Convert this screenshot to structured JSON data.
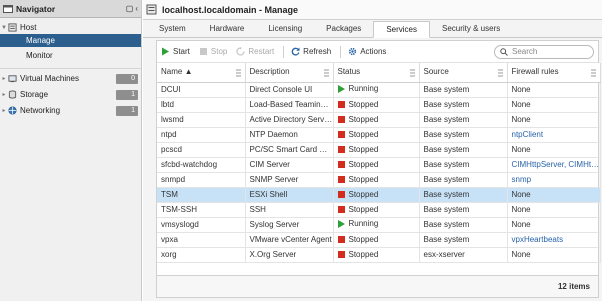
{
  "navigator": {
    "title": "Navigator",
    "items": [
      {
        "label": "Host",
        "type": "host"
      },
      {
        "label": "Manage",
        "type": "child"
      },
      {
        "label": "Monitor",
        "type": "child"
      },
      {
        "label": "Virtual Machines",
        "badge": "0"
      },
      {
        "label": "Storage",
        "badge": "1"
      },
      {
        "label": "Networking",
        "badge": "1"
      }
    ]
  },
  "main": {
    "title": "localhost.localdomain - Manage",
    "tabs": [
      "System",
      "Hardware",
      "Licensing",
      "Packages",
      "Services",
      "Security & users"
    ],
    "active_tab": "Services"
  },
  "toolbar": {
    "start": "Start",
    "stop": "Stop",
    "restart": "Restart",
    "refresh": "Refresh",
    "actions": "Actions",
    "search_placeholder": "Search"
  },
  "table": {
    "columns": [
      "Name ▲",
      "Description",
      "Status",
      "Source",
      "Firewall rules"
    ],
    "rows": [
      {
        "name": "DCUI",
        "desc": "Direct Console UI",
        "status": "Running",
        "source": "Base system",
        "fw": "None"
      },
      {
        "name": "lbtd",
        "desc": "Load-Based Teaming Daemon",
        "status": "Stopped",
        "source": "Base system",
        "fw": "None"
      },
      {
        "name": "lwsmd",
        "desc": "Active Directory Service",
        "status": "Stopped",
        "source": "Base system",
        "fw": "None"
      },
      {
        "name": "ntpd",
        "desc": "NTP Daemon",
        "status": "Stopped",
        "source": "Base system",
        "fw": "ntpClient"
      },
      {
        "name": "pcscd",
        "desc": "PC/SC Smart Card Daemon",
        "status": "Stopped",
        "source": "Base system",
        "fw": "None"
      },
      {
        "name": "sfcbd-watchdog",
        "desc": "CIM Server",
        "status": "Stopped",
        "source": "Base system",
        "fw": "CIMHttpServer, CIMHttpsServer"
      },
      {
        "name": "snmpd",
        "desc": "SNMP Server",
        "status": "Stopped",
        "source": "Base system",
        "fw": "snmp"
      },
      {
        "name": "TSM",
        "desc": "ESXi Shell",
        "status": "Stopped",
        "source": "Base system",
        "fw": "None"
      },
      {
        "name": "TSM-SSH",
        "desc": "SSH",
        "status": "Stopped",
        "source": "Base system",
        "fw": "None"
      },
      {
        "name": "vmsyslogd",
        "desc": "Syslog Server",
        "status": "Running",
        "source": "Base system",
        "fw": "None"
      },
      {
        "name": "vpxa",
        "desc": "VMware vCenter Agent",
        "status": "Stopped",
        "source": "Base system",
        "fw": "vpxHeartbeats"
      },
      {
        "name": "xorg",
        "desc": "X.Org Server",
        "status": "Stopped",
        "source": "esx-xserver",
        "fw": "None"
      }
    ],
    "selected_row": 7
  },
  "footer": {
    "count": "12 items"
  },
  "colors": {
    "selected_nav": "#2c5f8e",
    "selected_row": "#c7e2f7",
    "running": "#2fa037",
    "stopped": "#d22c1f",
    "link": "#2863a8"
  }
}
